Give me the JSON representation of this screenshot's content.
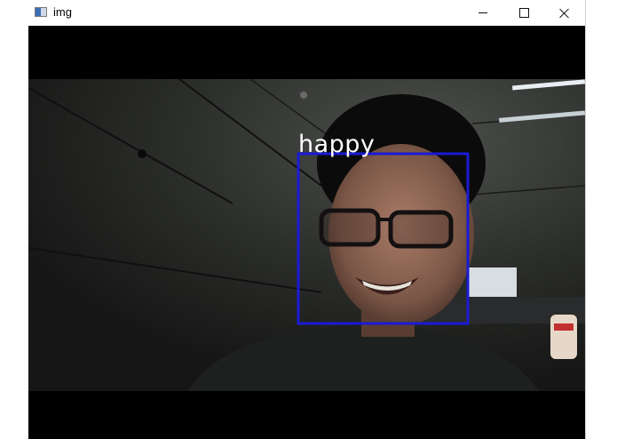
{
  "window": {
    "title": "img",
    "controls": {
      "minimize_icon": "minimize-icon",
      "maximize_icon": "maximize-icon",
      "close_icon": "close-icon"
    }
  },
  "detection": {
    "label": "happy",
    "box_color": "#1a1ad6",
    "label_color": "#ffffff"
  }
}
